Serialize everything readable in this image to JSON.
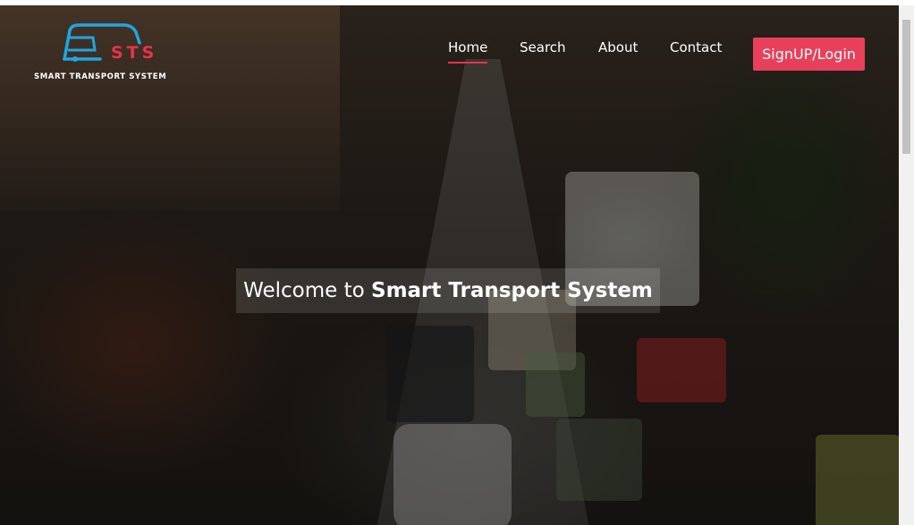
{
  "logo": {
    "mark_text": "STS",
    "tagline": "SMART TRANSPORT SYSTEM",
    "icon": "bus-icon",
    "accent_color": "#e8324e",
    "icon_color": "#1ea7e0"
  },
  "nav": {
    "items": [
      {
        "label": "Home",
        "active": true
      },
      {
        "label": "Search",
        "active": false
      },
      {
        "label": "About",
        "active": false
      },
      {
        "label": "Contact",
        "active": false
      }
    ],
    "cta_label": "SignUP/Login",
    "cta_color": "#e8405a"
  },
  "hero": {
    "welcome_prefix": "Welcome to",
    "welcome_emphasis": "Smart Transport System"
  }
}
